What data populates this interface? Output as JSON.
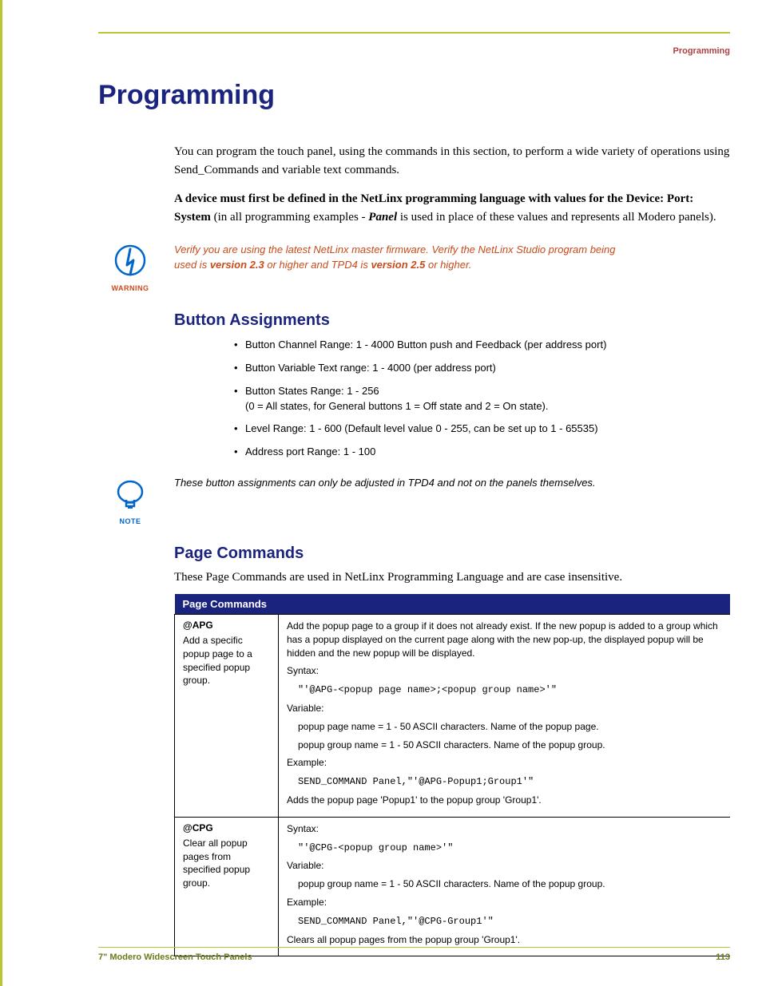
{
  "header": {
    "label": "Programming"
  },
  "title": "Programming",
  "intro": {
    "p1": "You can program the touch panel, using the commands in this section, to perform a wide variety of operations using Send_Commands and variable text commands.",
    "p2_prefix": "A device must first be defined in the NetLinx programming language with values for the Device: Port: System",
    "p2_mid": " (in all programming examples - ",
    "p2_panel": "Panel",
    "p2_suffix": " is used in place of these values and represents all Modero panels)."
  },
  "warning": {
    "label": "WARNING",
    "text_prefix": "Verify you are using the latest NetLinx master firmware. Verify the NetLinx Studio program being used is ",
    "v1": "version 2.3",
    "mid": " or higher and TPD4 is ",
    "v2": "version 2.5",
    "suffix": " or higher."
  },
  "sections": {
    "button_assignments": {
      "heading": "Button Assignments",
      "bullets": [
        "Button Channel Range: 1 - 4000 Button push and Feedback (per address port)",
        "Button Variable Text range: 1 - 4000 (per address port)",
        "Button States Range: 1 - 256\n(0 = All states, for General buttons 1 = Off state and 2 = On state).",
        "Level Range: 1 - 600 (Default level value 0 - 255, can be set up to 1 - 65535)",
        "Address port Range: 1 - 100"
      ]
    },
    "note": {
      "label": "NOTE",
      "text": "These button assignments can only be adjusted in TPD4 and not on the panels themselves."
    },
    "page_commands": {
      "heading": "Page Commands",
      "intro": "These Page Commands are used in NetLinx Programming Language and are case insensitive.",
      "table_title": "Page Commands",
      "rows": [
        {
          "name": "@APG",
          "desc": "Add a specific popup page to a specified popup group.",
          "body": {
            "overview": "Add the popup page to a group if it does not already exist. If the new popup is added to a group which has a popup displayed on the current page along with the new pop-up, the displayed popup will be hidden and the new popup will be displayed.",
            "syntax_label": "Syntax:",
            "syntax_code": "\"'@APG-<popup page name>;<popup group name>'\"",
            "variable_label": "Variable:",
            "var1": "popup page name = 1 - 50 ASCII characters. Name of the popup page.",
            "var2": "popup group name = 1 - 50 ASCII characters. Name of the popup group.",
            "example_label": "Example:",
            "example_code": "SEND_COMMAND Panel,\"'@APG-Popup1;Group1'\"",
            "result": "Adds the popup page 'Popup1' to the popup group 'Group1'."
          }
        },
        {
          "name": "@CPG",
          "desc": "Clear all popup pages from specified popup group.",
          "body": {
            "syntax_label": "Syntax:",
            "syntax_code": "\"'@CPG-<popup group name>'\"",
            "variable_label": "Variable:",
            "var1": "popup group name = 1 - 50 ASCII characters. Name of the popup group.",
            "example_label": "Example:",
            "example_code": "SEND_COMMAND Panel,\"'@CPG-Group1'\"",
            "result": "Clears all popup pages from the popup group 'Group1'."
          }
        }
      ]
    }
  },
  "footer": {
    "left": "7\" Modero Widescreen Touch Panels",
    "right": "113"
  }
}
